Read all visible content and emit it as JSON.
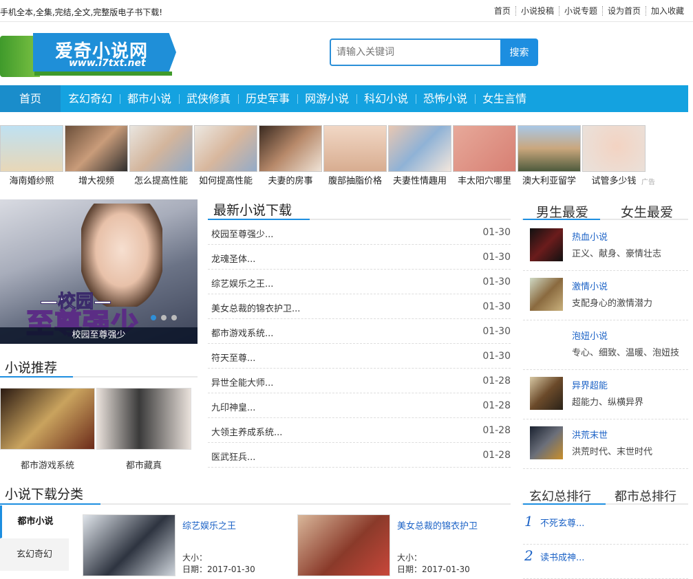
{
  "topbar": {
    "slogan": "手机全本,全集,完结,全文,完整版电子书下载!",
    "links": [
      "首页",
      "小说投稿",
      "小说专题",
      "设为首页",
      "加入收藏"
    ]
  },
  "logo": {
    "title": "爱奇小说网",
    "url": "www.i7txt.net"
  },
  "search": {
    "placeholder": "请输入关键词",
    "button": "搜索"
  },
  "nav": [
    "首页",
    "玄幻奇幻",
    "都市小说",
    "武侠修真",
    "历史军事",
    "网游小说",
    "科幻小说",
    "恐怖小说",
    "女生言情"
  ],
  "ads": {
    "items": [
      "海南婚纱照",
      "增大视频",
      "怎么提高性能",
      "如何提高性能",
      "夫妻的房事",
      "腹部抽脂价格",
      "夫妻性情趣用",
      "丰太阳穴哪里",
      "澳大利亚留学",
      "试管多少钱"
    ],
    "tag": "广告"
  },
  "slider": {
    "title_small": "—校园—",
    "title_big": "至尊强少",
    "caption": "校园至尊强少"
  },
  "latest": {
    "heading": "最新小说下载",
    "rows": [
      {
        "title": "校园至尊强少...",
        "date": "01-30"
      },
      {
        "title": "龙魂圣体...",
        "date": "01-30"
      },
      {
        "title": "综艺娱乐之王...",
        "date": "01-30"
      },
      {
        "title": "美女总裁的锦衣护卫...",
        "date": "01-30"
      },
      {
        "title": "都市游戏系统...",
        "date": "01-30"
      },
      {
        "title": "符天至尊...",
        "date": "01-30"
      },
      {
        "title": "异世全能大师...",
        "date": "01-28"
      },
      {
        "title": "九印神皇...",
        "date": "01-28"
      },
      {
        "title": "大领主养成系统...",
        "date": "01-28"
      },
      {
        "title": "医武狂兵...",
        "date": "01-28"
      }
    ]
  },
  "favorites": {
    "tabs": [
      "男生最爱",
      "女生最爱"
    ],
    "genres": [
      {
        "title": "热血小说",
        "desc": "正义、献身、豪情壮志"
      },
      {
        "title": "激情小说",
        "desc": "支配身心的激情潜力"
      },
      {
        "title": "泡妞小说",
        "desc": "专心、细致、温暖、泡妞技"
      },
      {
        "title": "异界超能",
        "desc": "超能力、纵横异界"
      },
      {
        "title": "洪荒末世",
        "desc": "洪荒时代、末世时代"
      }
    ]
  },
  "recommend": {
    "heading": "小说推荐",
    "books": [
      "都市游戏系统",
      "都市藏真"
    ]
  },
  "categories": {
    "heading": "小说下载分类",
    "side": [
      "都市小说",
      "玄幻奇幻"
    ],
    "books": [
      {
        "title": "综艺娱乐之王",
        "size": "大小：",
        "date": "日期：2017-01-30"
      },
      {
        "title": "美女总裁的锦衣护卫",
        "size": "大小：",
        "date": "日期：2017-01-30"
      }
    ]
  },
  "ranking": {
    "tabs": [
      "玄幻总排行",
      "都市总排行"
    ],
    "rows": [
      {
        "num": "1",
        "title": "不死玄尊..."
      },
      {
        "num": "2",
        "title": "读书成神..."
      }
    ]
  }
}
